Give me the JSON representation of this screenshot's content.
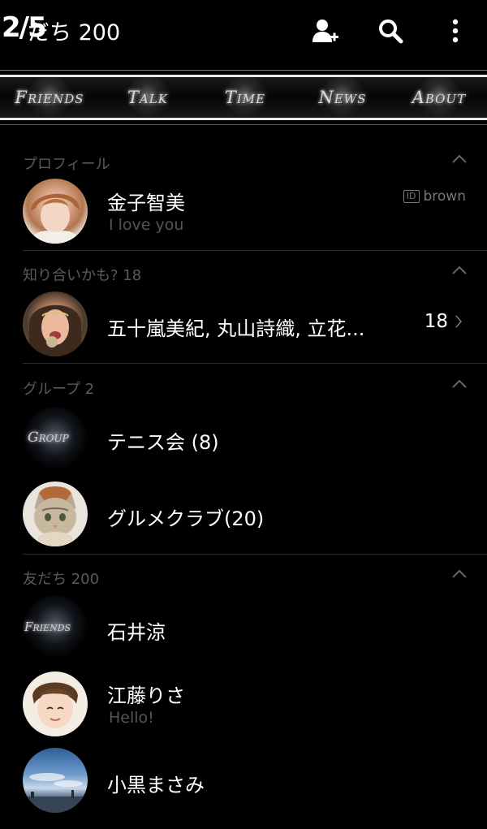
{
  "header": {
    "page_indicator": "2/5",
    "title": "だち 200",
    "icons": [
      "add-friend-icon",
      "search-icon",
      "more-icon"
    ]
  },
  "tabs": [
    {
      "label": "Friends"
    },
    {
      "label": "Talk"
    },
    {
      "label": "Time"
    },
    {
      "label": "News"
    },
    {
      "label": "About"
    }
  ],
  "profile_section": {
    "label": "プロフィール",
    "name": "金子智美",
    "status": "I love you",
    "id_badge": "ID",
    "id_value": "brown"
  },
  "suggested_section": {
    "label": "知り合いかも? 18",
    "names": "五十嵐美紀, 丸山詩織, 立花...",
    "count": "18"
  },
  "groups_section": {
    "label": "グループ  2",
    "groups": [
      {
        "name": "テニス会 (8)",
        "logo_text": "Group"
      },
      {
        "name": "グルメクラブ(20)"
      }
    ]
  },
  "friends_section": {
    "label": "友だち 200",
    "friends": [
      {
        "name": "石井涼",
        "logo_text": "Friends"
      },
      {
        "name": "江藤りさ",
        "status": "Hello!"
      },
      {
        "name": "小黒まさみ"
      }
    ]
  },
  "colors": {
    "background": "#000000",
    "section_label": "#5a5a5a",
    "divider": "#2a2a2a"
  }
}
